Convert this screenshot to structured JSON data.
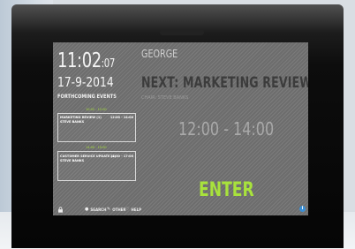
{
  "status": {
    "time": "11:02",
    "seconds": ":07",
    "date": "17-9-2014"
  },
  "forthcoming": {
    "title": "FORTHCOMING EVENTS",
    "events": [
      {
        "time_label": "10:02 - 12:00",
        "title": "MARKETING REVIEW (1)",
        "time": "12:00 - 14:00",
        "host": "STEVE BANKS"
      },
      {
        "time_label": "14:00 - 15:00",
        "title": "CUSTOMER SERVICE UPDATE (2)",
        "time": "14:30 - 17:00",
        "host": "STEVE BANKS"
      }
    ]
  },
  "meeting": {
    "user": "GEORGE",
    "next_title": "NEXT: MARKETING REVIEW",
    "chair": "CHAIR: STEVE BANKS",
    "time_range": "12:00 - 14:00",
    "enter_label": "ENTER"
  },
  "footer": {
    "lock_icon": "lock-icon",
    "items": [
      {
        "icon": "search-icon",
        "glyph": "●",
        "label": "SEARCH"
      },
      {
        "icon": "pencil-icon",
        "glyph": "✎",
        "label": "OTHER"
      },
      {
        "icon": "help-icon",
        "glyph": "♡",
        "label": "HELP"
      }
    ],
    "info_icon": "info-icon"
  },
  "colors": {
    "accent": "#a8e23c",
    "screen_bg": "#727272",
    "info": "#3a8fd6"
  }
}
